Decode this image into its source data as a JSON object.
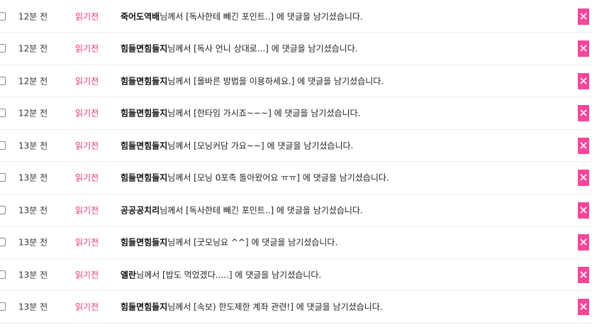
{
  "notifications": [
    {
      "time": "12분 전",
      "status": "읽기전",
      "nick": "죽어도역배",
      "suffix": "님께서 [독사한테 빼긴 포인트..] 에 댓글을 남기셨습니다."
    },
    {
      "time": "12분 전",
      "status": "읽기전",
      "nick": "힘들면힘들지",
      "suffix": "님께서 [독사 언니 상대로...] 에 댓글을 남기셨습니다."
    },
    {
      "time": "12분 전",
      "status": "읽기전",
      "nick": "힘들면힘들지",
      "suffix": "님께서 [올바른 방법을 이용하세요.] 에 댓글을 남기셨습니다."
    },
    {
      "time": "12분 전",
      "status": "읽기전",
      "nick": "힘들면힘들지",
      "suffix": "님께서 [한타임 가시죠~~~] 에 댓글을 남기셨습니다."
    },
    {
      "time": "13분 전",
      "status": "읽기전",
      "nick": "힘들면힘들지",
      "suffix": "님께서 [모닝커담 가요~~] 에 댓글을 남기셨습니다."
    },
    {
      "time": "13분 전",
      "status": "읽기전",
      "nick": "힘들면힘들지",
      "suffix": "님께서 [모닝 0포족 돌아왔어요 ㅠㅠ] 에 댓글을 남기셨습니다."
    },
    {
      "time": "13분 전",
      "status": "읽기전",
      "nick": "공공공치리",
      "suffix": "님께서 [독사한테 빼긴 포인트..] 에 댓글을 남기셨습니다."
    },
    {
      "time": "13분 전",
      "status": "읽기전",
      "nick": "힘들면힘들지",
      "suffix": "님께서 [굿모닝요 ^^] 에 댓글을 남기셨습니다."
    },
    {
      "time": "13분 전",
      "status": "읽기전",
      "nick": "엘란",
      "suffix": "님께서 [밥도 먹었겠다.....] 에 댓글을 남기셨습니다."
    },
    {
      "time": "13분 전",
      "status": "읽기전",
      "nick": "힘들면힘들지",
      "suffix": "님께서 [속보) 한도제한 계좌 관련!] 에 댓글을 남기셨습니다."
    }
  ],
  "colors": {
    "unread": "#e8336d",
    "delete_button": "#f5479a"
  },
  "icons": {
    "select": "checkbox-icon",
    "delete": "close-icon"
  }
}
